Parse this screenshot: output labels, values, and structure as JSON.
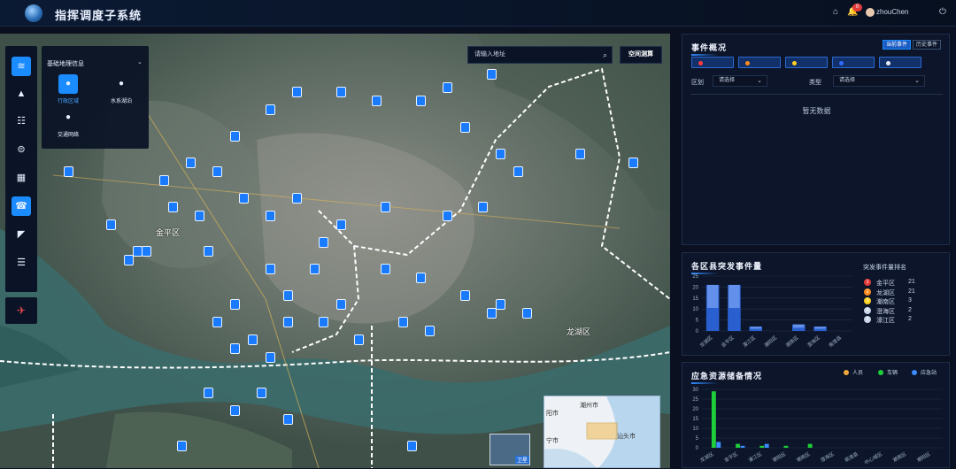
{
  "app": {
    "title": "指挥调度子系统",
    "user": "zhouChen",
    "notification_count": "0"
  },
  "map": {
    "search_placeholder": "请输入地址",
    "space_button": "空间测算",
    "labels": [
      "金平区",
      "龙湖区",
      "汕头市",
      "潮州市"
    ],
    "minimap_labels": [
      "潮州市",
      "汕头市",
      "阳市",
      "宁市"
    ],
    "sat_label": "卫星",
    "layer_panel": {
      "title": "基础地理信息",
      "items": [
        {
          "label": "行政区域",
          "icon": "user-icon",
          "active": true
        },
        {
          "label": "水系湖泊",
          "icon": "user-icon",
          "active": false
        },
        {
          "label": "交通网络",
          "icon": "user-icon",
          "active": false
        }
      ]
    },
    "rail_icons": [
      "layers-icon",
      "warning-icon",
      "org-icon",
      "alarm-icon",
      "apps-icon",
      "phone-icon",
      "camera-icon",
      "search-list-icon"
    ],
    "rail_bottom_icon": "satellite-icon"
  },
  "events": {
    "title": "事件概况",
    "tabs": [
      "当前事件",
      "历史事件"
    ],
    "levels": [
      {
        "color": "#ff3b3b"
      },
      {
        "color": "#ff8c1a"
      },
      {
        "color": "#ffd21f"
      },
      {
        "color": "#2f6bff"
      },
      {
        "color": "#e8eef7"
      }
    ],
    "filter_district_label": "区划",
    "filter_type_label": "类型",
    "select_placeholder": "请选择",
    "empty_text": "暂无数据"
  },
  "district_chart": {
    "title": "各区县突发事件量",
    "rank_title": "突发事件量排名",
    "ranking": [
      {
        "no": "1",
        "name": "金平区",
        "count": "21",
        "color": "#e23b3b"
      },
      {
        "no": "2",
        "name": "龙湖区",
        "count": "21",
        "color": "#ff8c1a"
      },
      {
        "no": "3",
        "name": "潮南区",
        "count": "3",
        "color": "#ffd21f"
      },
      {
        "no": "4",
        "name": "澄海区",
        "count": "2",
        "color": "#c9d6e8"
      },
      {
        "no": "5",
        "name": "濠江区",
        "count": "2",
        "color": "#c9d6e8"
      }
    ]
  },
  "resource_chart": {
    "title": "应急资源储备情况",
    "legend": [
      {
        "name": "人员",
        "color": "#f2a93b"
      },
      {
        "name": "车辆",
        "color": "#1fcf3a"
      },
      {
        "name": "应急站",
        "color": "#3c8cff"
      }
    ]
  },
  "chart_data": [
    {
      "type": "bar",
      "title": "各区县突发事件量",
      "categories": [
        "龙湖区",
        "金平区",
        "濠江区",
        "潮阳区",
        "潮南区",
        "澄海区",
        "南澳县"
      ],
      "values": [
        21,
        21,
        2,
        0,
        3,
        2,
        0
      ],
      "ylim": [
        0,
        25
      ],
      "yticks": [
        0,
        5,
        10,
        15,
        20,
        25
      ],
      "grid": true
    },
    {
      "type": "bar",
      "title": "应急资源储备情况",
      "categories": [
        "龙湖区",
        "金平区",
        "濠江区",
        "潮阳区",
        "潮南区",
        "澄海区",
        "南澳县",
        "中心城区",
        "潮南区",
        "潮阳区"
      ],
      "series": [
        {
          "name": "人员",
          "values": [
            0,
            0,
            0,
            0,
            0,
            0,
            0,
            0,
            0,
            0
          ]
        },
        {
          "name": "车辆",
          "values": [
            29,
            2,
            1,
            1,
            2,
            0,
            0,
            0,
            0,
            0
          ]
        },
        {
          "name": "应急站",
          "values": [
            3,
            1,
            2,
            0,
            0,
            0,
            0,
            0,
            0,
            0
          ]
        }
      ],
      "ylim": [
        0,
        30
      ],
      "yticks": [
        0,
        5,
        10,
        15,
        20,
        25,
        30
      ],
      "grid": true
    }
  ]
}
